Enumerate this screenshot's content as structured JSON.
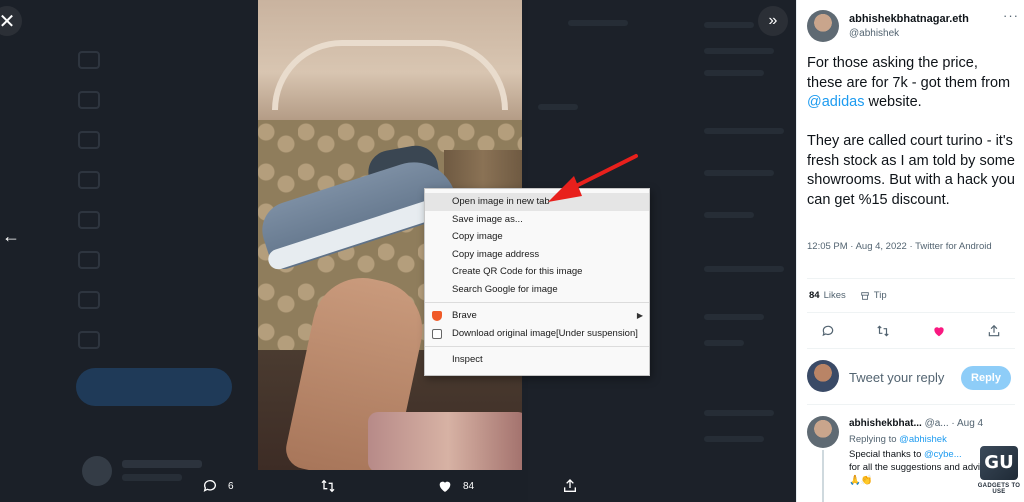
{
  "lightbox": {
    "close_glyph": "✕",
    "expand_glyph": "»",
    "back_glyph": "←",
    "actions": {
      "reply_count": "6",
      "retweet_count": "",
      "like_count": "84",
      "share_count": ""
    }
  },
  "context_menu": {
    "items": [
      "Open image in new tab",
      "Save image as...",
      "Copy image",
      "Copy image address",
      "Create QR Code for this image",
      "Search Google for image",
      "Brave",
      "Download original image[Under suspension]",
      "Inspect"
    ],
    "highlighted_index": 0
  },
  "tweet": {
    "author_name": "abhishekbhatnagar.eth",
    "author_handle": "@abhishek",
    "more_glyph": "···",
    "text_part1": "For those asking the price, these are for 7k - got them from ",
    "text_link": "@adidas",
    "text_part2": " website.",
    "text_para2": "They are called court turino - it's fresh stock as I am told by some showrooms. But with a hack you can get %15 discount.",
    "meta": "12:05 PM · Aug 4, 2022 · Twitter for Android",
    "likes_count": "84",
    "likes_label": "Likes",
    "tip_label": "Tip",
    "reply_placeholder": "Tweet your reply",
    "reply_button": "Reply"
  },
  "reply": {
    "author_name": "abhishekbhat...",
    "author_handle": "@a...",
    "date": "· Aug 4",
    "replying_label": "Replying to ",
    "replying_handle": "@abhishek",
    "body_prefix": "Special thanks to ",
    "body_mention": "@cybe...",
    "body_line2": "for all the suggestions and advice",
    "body_line3": "🙏👏"
  },
  "watermark": {
    "logo": "GU",
    "text": "GADGETS TO USE"
  },
  "colors": {
    "accent": "#1d9bf0",
    "like": "#f91880",
    "arrow": "#e8201c"
  }
}
